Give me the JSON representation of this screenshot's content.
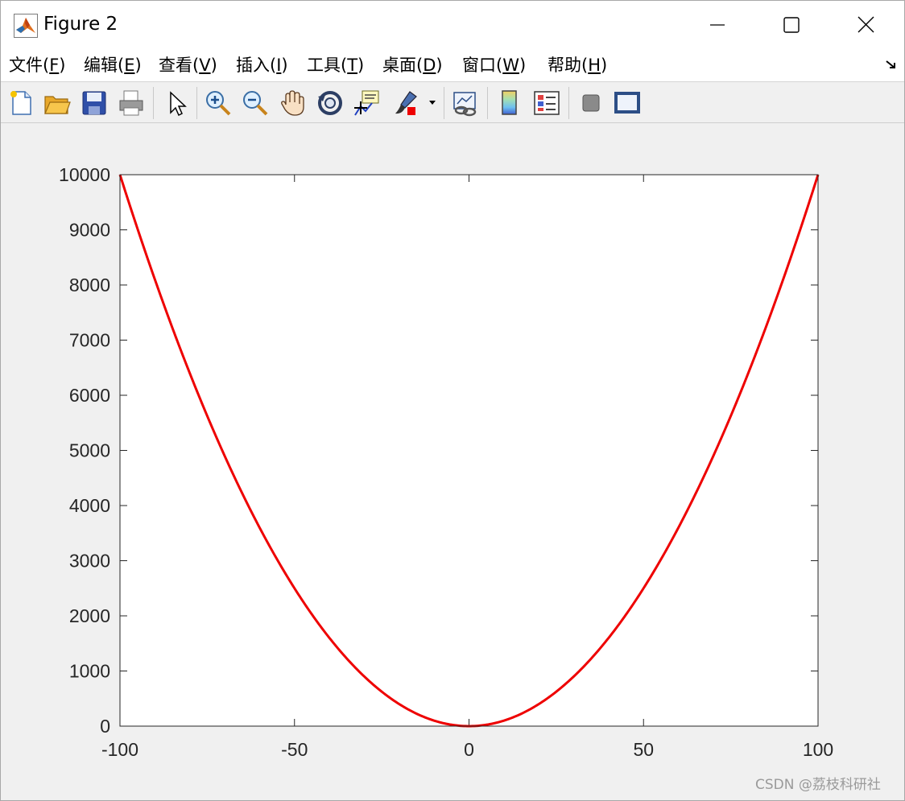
{
  "window": {
    "title": "Figure 2",
    "icon": "matlab-icon"
  },
  "menubar": {
    "items": [
      {
        "text": "文件(",
        "mnemonic": "F",
        "close": ")"
      },
      {
        "text": "编辑(",
        "mnemonic": "E",
        "close": ")"
      },
      {
        "text": "查看(",
        "mnemonic": "V",
        "close": ")"
      },
      {
        "text": "插入(",
        "mnemonic": "I",
        "close": ")"
      },
      {
        "text": "工具(",
        "mnemonic": "T",
        "close": ")"
      },
      {
        "text": "桌面(",
        "mnemonic": "D",
        "close": ")"
      },
      {
        "text": "窗口(",
        "mnemonic": "W",
        "close": ")"
      },
      {
        "text": "帮助(",
        "mnemonic": "H",
        "close": ")"
      }
    ]
  },
  "toolbar": {
    "buttons": [
      "new-figure-icon",
      "open-file-icon",
      "save-icon",
      "print-icon",
      "edit-plot-arrow-icon",
      "zoom-in-icon",
      "zoom-out-icon",
      "pan-hand-icon",
      "rotate-3d-icon",
      "data-cursor-icon",
      "brush-icon",
      "link-plot-icon",
      "colorbar-icon",
      "legend-icon",
      "hide-plot-tools-icon",
      "show-plot-tools-icon"
    ]
  },
  "chart_data": {
    "type": "line",
    "function": "y = x^2",
    "x_range": [
      -100,
      100
    ],
    "xlim": [
      -100,
      100
    ],
    "ylim": [
      0,
      10000
    ],
    "xticks": [
      "-100",
      "-50",
      "0",
      "50",
      "100"
    ],
    "yticks": [
      "0",
      "1000",
      "2000",
      "3000",
      "4000",
      "5000",
      "6000",
      "7000",
      "8000",
      "9000",
      "10000"
    ],
    "series": [
      {
        "color": "#ee0000",
        "x": [
          -100,
          -90,
          -80,
          -70,
          -60,
          -50,
          -40,
          -30,
          -20,
          -10,
          0,
          10,
          20,
          30,
          40,
          50,
          60,
          70,
          80,
          90,
          100
        ],
        "y": [
          10000,
          8100,
          6400,
          4900,
          3600,
          2500,
          1600,
          900,
          400,
          100,
          0,
          100,
          400,
          900,
          1600,
          2500,
          3600,
          4900,
          6400,
          8100,
          10000
        ]
      }
    ],
    "grid": false
  },
  "watermark": "CSDN @荔枝科研社"
}
